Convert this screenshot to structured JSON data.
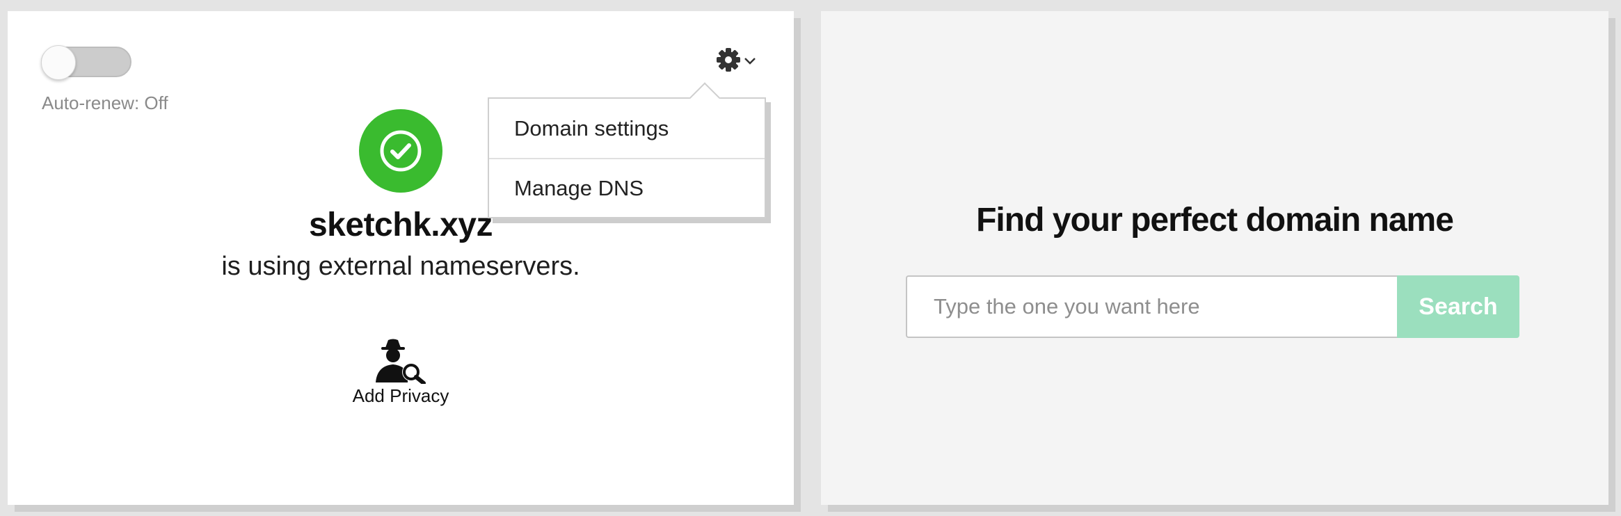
{
  "domain_card": {
    "auto_renew_label": "Auto-renew: Off",
    "auto_renew_on": false,
    "domain": "sketchk.xyz",
    "status_text": "is using external nameservers.",
    "status_icon": "check-circle-icon",
    "status_color": "#3abb2f",
    "privacy_label": "Add Privacy",
    "privacy_icon": "privacy-agent-search-icon"
  },
  "settings_menu": {
    "icon": "gear-icon",
    "items": [
      {
        "label": "Domain settings"
      },
      {
        "label": "Manage DNS"
      }
    ]
  },
  "search_card": {
    "title": "Find your perfect domain name",
    "placeholder": "Type the one you want here",
    "button_label": "Search",
    "button_color": "#9bdfbe"
  }
}
